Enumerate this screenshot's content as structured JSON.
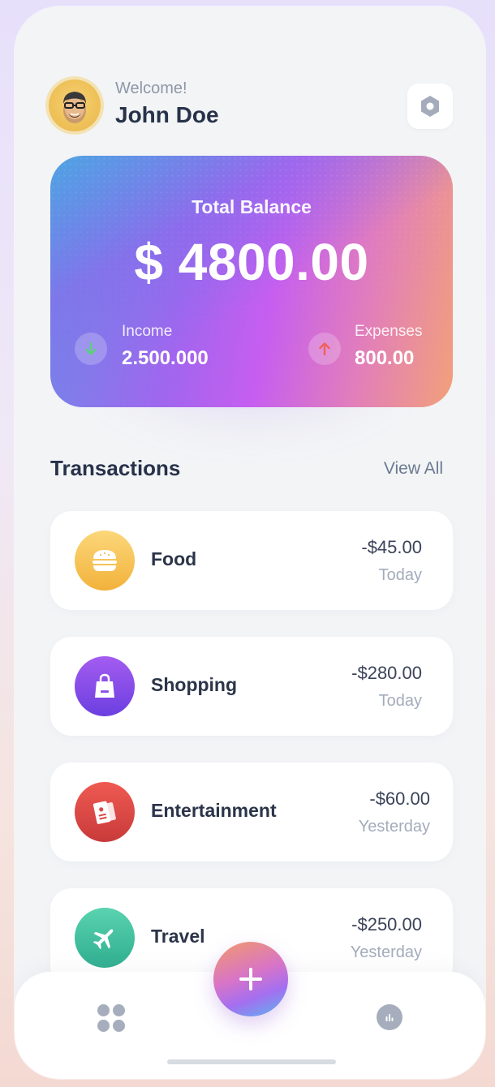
{
  "header": {
    "welcome_text": "Welcome!",
    "user_name": "John Doe",
    "avatar_icon": "memoji-avatar-icon",
    "settings_icon": "hexagon-settings-icon"
  },
  "balance": {
    "title": "Total Balance",
    "amount": "$ 4800.00",
    "income": {
      "label": "Income",
      "value": "2.500.000",
      "icon": "arrow-down-icon",
      "icon_color": "#5cd07a"
    },
    "expenses": {
      "label": "Expenses",
      "value": "800.00",
      "icon": "arrow-up-icon",
      "icon_color": "#f0605a"
    }
  },
  "transactions": {
    "title": "Transactions",
    "view_all_label": "View All",
    "items": [
      {
        "name": "Food",
        "amount": "-$45.00",
        "date": "Today",
        "icon": "burger-icon",
        "color_from": "#fcd77a",
        "color_to": "#f2b23b"
      },
      {
        "name": "Shopping",
        "amount": "-$280.00",
        "date": "Today",
        "icon": "shopping-bag-icon",
        "color_from": "#a45cf0",
        "color_to": "#6b3fe0"
      },
      {
        "name": "Entertainment",
        "amount": "-$60.00",
        "date": "Yesterday",
        "icon": "ticket-icon",
        "color_from": "#ef5a52",
        "color_to": "#c83a3a"
      },
      {
        "name": "Travel",
        "amount": "-$250.00",
        "date": "Yesterday",
        "icon": "airplane-icon",
        "color_from": "#5ad3b0",
        "color_to": "#2fae8f"
      }
    ]
  },
  "bottom_nav": {
    "home_icon": "grid-dots-icon",
    "add_icon": "plus-icon",
    "stats_icon": "bar-chart-icon"
  }
}
